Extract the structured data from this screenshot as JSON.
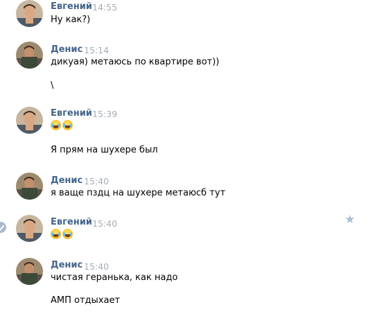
{
  "messages": [
    {
      "author": "Евгений",
      "time": "14:55",
      "lines": [
        "Ну как?)"
      ]
    },
    {
      "author": "Денис",
      "time": "15:14",
      "lines": [
        "дикуая) метаюсь по квартире вот))",
        "\\"
      ]
    },
    {
      "author": "Евгений",
      "time": "15:39",
      "emoji_line": "😂😂",
      "lines": [
        "Я прям на шухере был"
      ]
    },
    {
      "author": "Денис",
      "time": "15:40",
      "lines": [
        "я ваще пздц на шухере метаюсб тут"
      ]
    },
    {
      "author": "Евгений",
      "time": "15:40",
      "emoji_line": "😂😂"
    },
    {
      "author": "Денис",
      "time": "15:40",
      "lines": [
        "чистая геранька, как надо",
        "АМП отдыхает"
      ]
    }
  ],
  "icons": {
    "selected_check": "check-circle-icon",
    "favorite": "star-icon",
    "emoji": "face-with-tears-of-joy-emoji"
  },
  "colors": {
    "author": "#42648b",
    "time": "#a5adb6",
    "text": "#000000",
    "star": "#a8bcd4"
  }
}
